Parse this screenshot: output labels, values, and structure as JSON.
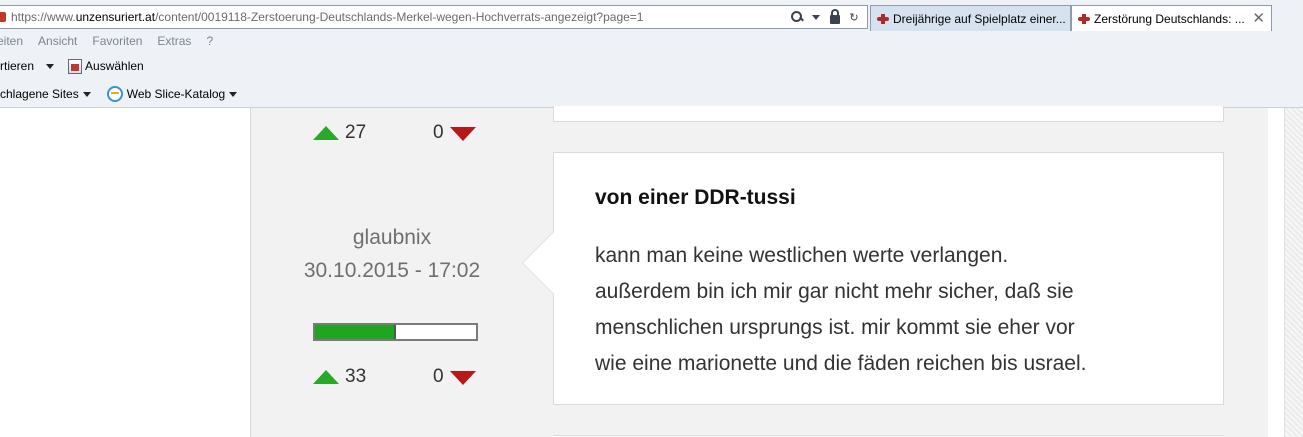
{
  "browser": {
    "address": {
      "prefix": "https://www.",
      "domain": "unzensuriert.at",
      "path": "/content/0019118-Zerstoerung-Deutschlands-Merkel-wegen-Hochverrats-angezeigt?page=1"
    },
    "tabs": [
      {
        "label": "Dreijährige auf Spielplatz einer..."
      },
      {
        "label": "Zerstörung Deutschlands: ..."
      }
    ],
    "tab_close": "✕",
    "menu": [
      "eiten",
      "Ansicht",
      "Favoriten",
      "Extras",
      "?"
    ],
    "commands": {
      "convert": "rtieren",
      "select": "Auswählen"
    },
    "favorites": {
      "suggested": "chlagene Sites",
      "webslice": "Web Slice-Katalog"
    }
  },
  "previous_comment": {
    "up_votes": "27",
    "down_votes": "0"
  },
  "comment": {
    "author": "glaubnix",
    "date": "30.10.2015 - 17:02",
    "rating_fraction": 0.5,
    "up_votes": "33",
    "down_votes": "0",
    "title": "von einer DDR-tussi",
    "body_lines": [
      "kann man keine westlichen werte verlangen.",
      "außerdem bin ich mir gar nicht mehr sicher, daß sie",
      "menschlichen ursprungs ist. mir kommt sie eher vor",
      "wie eine marionette und die fäden reichen bis usrael."
    ]
  },
  "colors": {
    "up_arrow": "#2aa82a",
    "down_arrow": "#b51919",
    "rating_fill": "#1fa51f"
  }
}
